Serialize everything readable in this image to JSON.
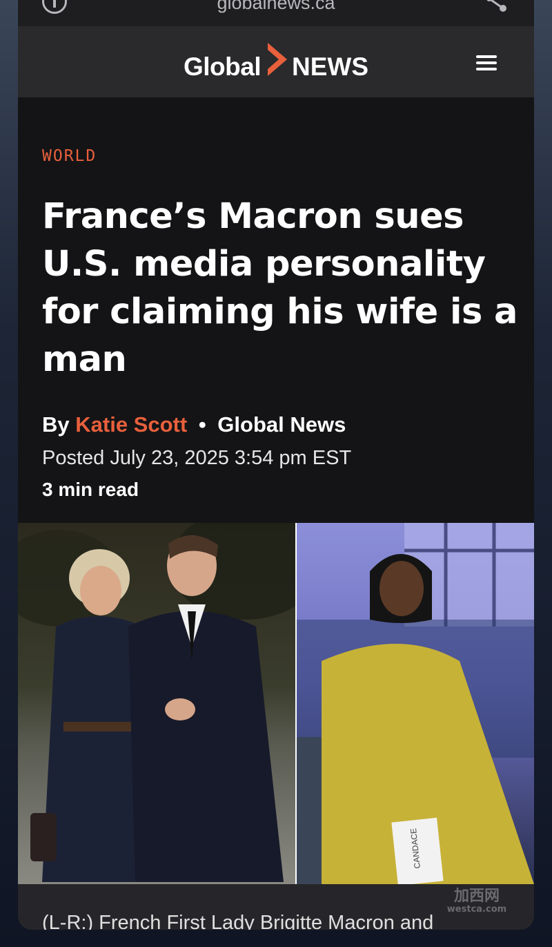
{
  "browser": {
    "url": "globalnews.ca"
  },
  "header": {
    "logo_left": "Global",
    "logo_right": "NEWS",
    "brand_color": "#e8603c"
  },
  "article": {
    "category": "WORLD",
    "headline": "France’s Macron sues U.S. media personality for claiming his wife is a man",
    "by_label": "By",
    "author": "Katie Scott",
    "separator": "•",
    "outlet": "Global News",
    "posted": "Posted July 23, 2025 3:54 pm EST",
    "read_time": "3 min read",
    "photo_text": "CANDACE",
    "caption": "(L-R:) French First Lady Brigitte Macron and"
  },
  "watermark": {
    "text_top": "加西网",
    "text_bottom": "westca.com"
  }
}
